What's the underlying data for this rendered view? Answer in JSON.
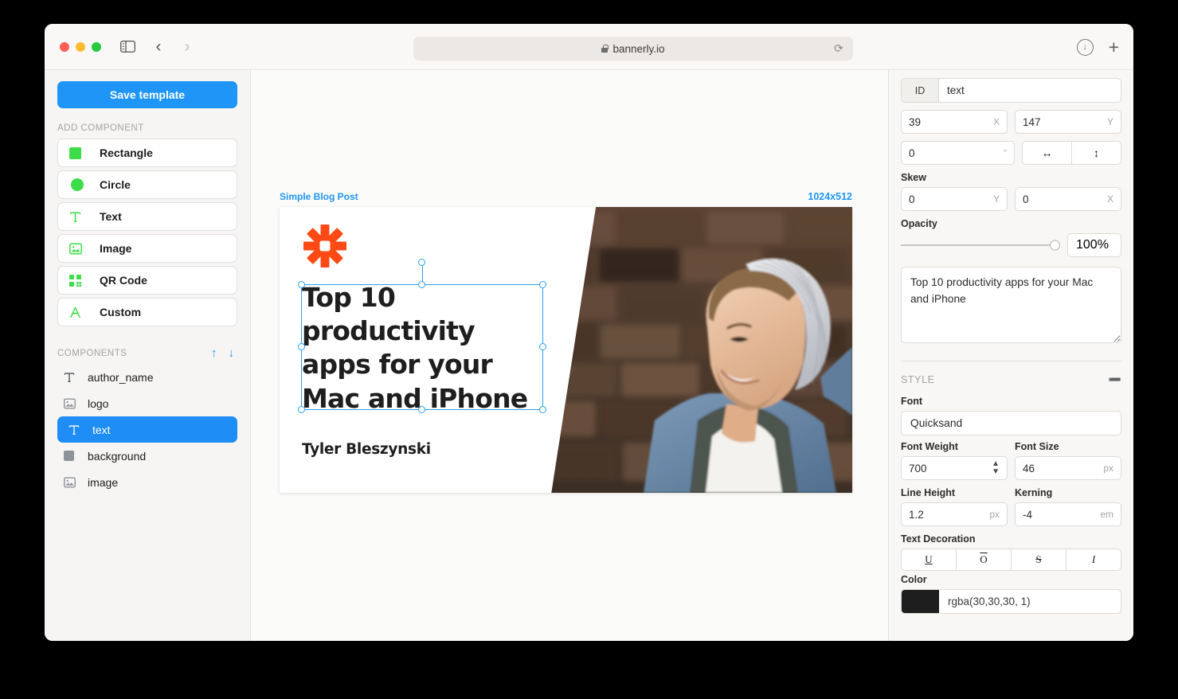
{
  "browser": {
    "url": "bannerly.io",
    "lock_icon": "lock-icon",
    "reload_icon": "reload-icon",
    "sidebar_toggle_icon": "sidebar-toggle-icon",
    "back_icon": "chevron-left-icon",
    "forward_icon": "chevron-right-icon",
    "download_icon": "download-icon",
    "new_tab_icon": "plus-icon"
  },
  "sidebar": {
    "save_label": "Save template",
    "add_component_label": "ADD COMPONENT",
    "components_label": "COMPONENTS",
    "move_up_icon": "arrow-up-icon",
    "move_down_icon": "arrow-down-icon",
    "add_items": [
      {
        "label": "Rectangle",
        "icon": "rectangle-icon"
      },
      {
        "label": "Circle",
        "icon": "circle-icon"
      },
      {
        "label": "Text",
        "icon": "text-icon"
      },
      {
        "label": "Image",
        "icon": "image-icon"
      },
      {
        "label": "QR Code",
        "icon": "qrcode-icon"
      },
      {
        "label": "Custom",
        "icon": "custom-icon"
      }
    ],
    "layers": [
      {
        "label": "author_name",
        "icon": "text-icon",
        "selected": false
      },
      {
        "label": "logo",
        "icon": "image-icon",
        "selected": false
      },
      {
        "label": "text",
        "icon": "text-icon",
        "selected": true
      },
      {
        "label": "background",
        "icon": "rectangle-icon",
        "selected": false
      },
      {
        "label": "image",
        "icon": "image-icon",
        "selected": false
      }
    ]
  },
  "canvas": {
    "template_name": "Simple Blog Post",
    "dimensions": "1024x512",
    "banner": {
      "title": "Top 10 productivity apps for your Mac and iPhone",
      "author": "Tyler Bleszynski",
      "logo_icon": "asterisk-logo-icon",
      "logo_color": "#ff4a16",
      "title_color": "#1e1e1e"
    }
  },
  "inspector": {
    "id_tag": "ID",
    "id_value": "text",
    "x_value": "39",
    "x_unit": "X",
    "y_value": "147",
    "y_unit": "Y",
    "rotation_value": "0",
    "rotation_unit": "°",
    "flip_horizontal_icon": "↔",
    "flip_vertical_icon": "↕",
    "skew_label": "Skew",
    "skew_y_value": "0",
    "skew_y_unit": "Y",
    "skew_x_value": "0",
    "skew_x_unit": "X",
    "opacity_label": "Opacity",
    "opacity_value": "100",
    "opacity_unit": "%",
    "text_value": "Top 10 productivity apps for your Mac and iPhone",
    "style_label": "STYLE",
    "style_chevron_icon": "chevron-down-icon",
    "font_label": "Font",
    "font_value": "Quicksand",
    "font_weight_label": "Font Weight",
    "font_weight_value": "700",
    "font_size_label": "Font Size",
    "font_size_value": "46",
    "font_size_unit": "px",
    "line_height_label": "Line Height",
    "line_height_value": "1.2",
    "line_height_unit": "px",
    "kerning_label": "Kerning",
    "kerning_value": "-4",
    "kerning_unit": "em",
    "text_decoration_label": "Text Decoration",
    "decoration_underline": "U",
    "decoration_overline": "O",
    "decoration_strikethrough": "S",
    "decoration_italic": "I",
    "color_label": "Color",
    "color_value": "rgba(30,30,30, 1)",
    "color_hex": "#1e1e1e",
    "accent_color": "#1e95f7"
  }
}
